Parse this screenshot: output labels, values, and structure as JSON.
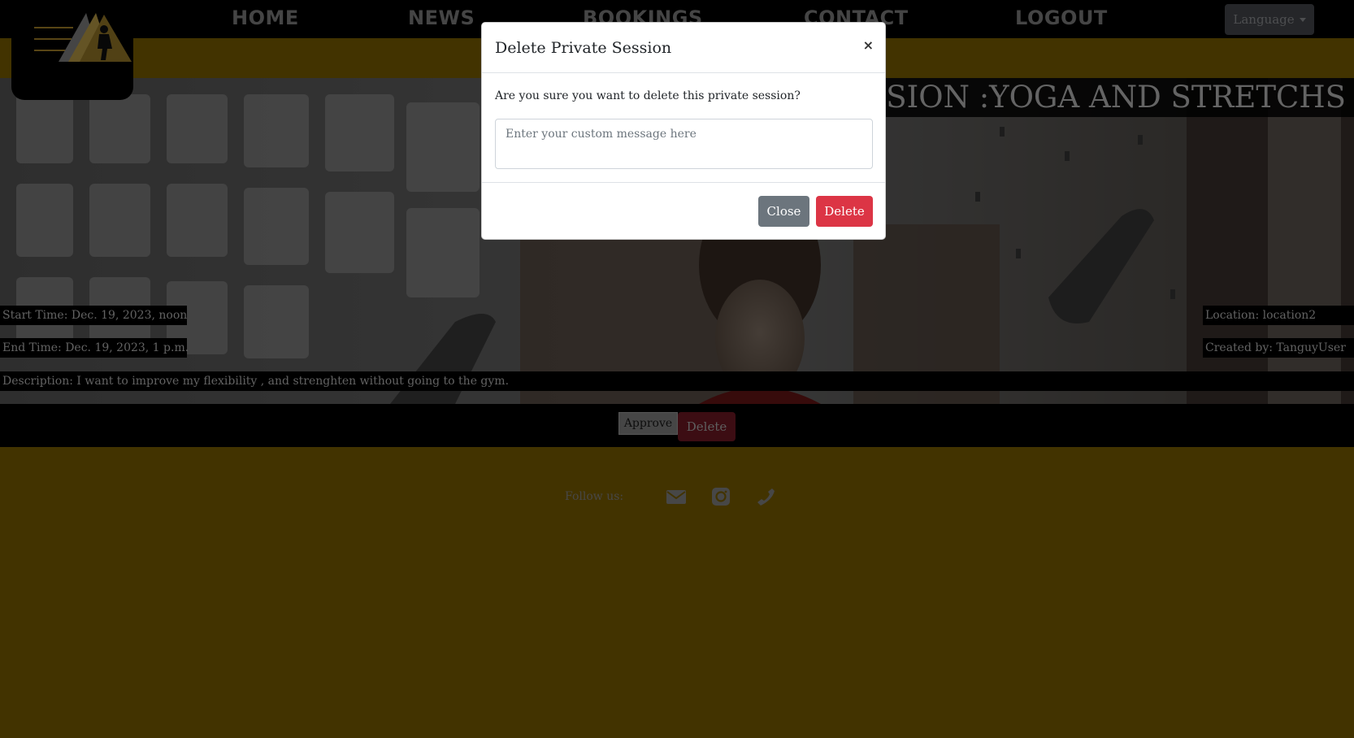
{
  "navbar": {
    "links": [
      "HOME",
      "NEWS",
      "BOOKINGS",
      "CONTACT",
      "LOGOUT"
    ],
    "language_label": "Language"
  },
  "session": {
    "title": "SESSION :YOGA AND STRETCHS",
    "start_time": "Start Time: Dec. 19, 2023, noon",
    "end_time": "End Time: Dec. 19, 2023, 1 p.m.",
    "location": "Location: location2",
    "created_by": "Created by: TanguyUser",
    "description": "Description: I want to improve my flexibility , and strenghten without going to the gym."
  },
  "actions": {
    "approve_label": "Approve",
    "delete_label": "Delete"
  },
  "footer": {
    "follow_label": "Follow us:",
    "icons": [
      "envelope-icon",
      "instagram-icon",
      "phone-icon"
    ]
  },
  "modal": {
    "title": "Delete Private Session",
    "close_symbol": "×",
    "question": "Are you sure you want to delete this private session?",
    "message_placeholder": "Enter your custom message here",
    "close_label": "Close",
    "delete_label": "Delete"
  },
  "colors": {
    "gold": "#856600",
    "danger": "#dc3545",
    "secondary": "#6c757d"
  }
}
